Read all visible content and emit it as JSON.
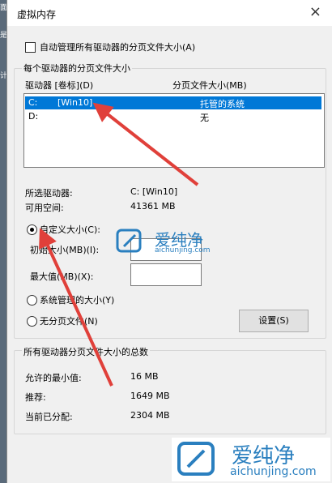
{
  "left_strip": {
    "texts": [
      "面",
      "是",
      "计"
    ]
  },
  "window": {
    "title": "虚拟内存",
    "close": "×"
  },
  "auto_manage": {
    "label": "自动管理所有驱动器的分页文件大小(A)",
    "checked": false
  },
  "per_drive": {
    "group_title": "每个驱动器的分页文件大小",
    "col_drive": "驱动器 [卷标](D)",
    "col_size": "分页文件大小(MB)",
    "rows": [
      {
        "drive": "C:",
        "label": "[Win10]",
        "size": "托管的系统",
        "selected": true
      },
      {
        "drive": "D:",
        "label": "",
        "size": "无",
        "selected": false
      }
    ],
    "selected_drive_label": "所选驱动器:",
    "selected_drive_value": "C:  [Win10]",
    "free_space_label": "可用空间:",
    "free_space_value": "41361 MB",
    "custom_size": "自定义大小(C):",
    "initial_size": "初始大小(MB)(I):",
    "initial_value": "",
    "max_size": "最大值(MB)(X):",
    "max_value": "",
    "system_managed": "系统管理的大小(Y)",
    "no_paging": "无分页文件(N)",
    "set_button": "设置(S)",
    "selected_option": "custom"
  },
  "totals": {
    "group_title": "所有驱动器分页文件大小的总数",
    "min_label": "允许的最小值:",
    "min_value": "16 MB",
    "recommended_label": "推荐:",
    "recommended_value": "1649 MB",
    "current_label": "当前已分配:",
    "current_value": "2304 MB"
  },
  "watermark_small": {
    "brand": "爱纯净",
    "url": "aichunjing.com"
  },
  "watermark_large": {
    "brand": "爱纯净",
    "url": "aichunjing.com"
  },
  "colors": {
    "selection": "#0078d7",
    "arrow": "#e0403a",
    "watermark": "#2a7fbf"
  }
}
